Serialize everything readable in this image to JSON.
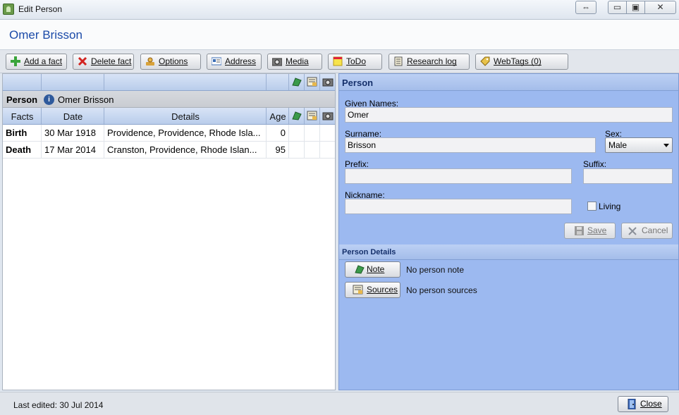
{
  "window": {
    "title": "Edit Person",
    "swap_glyph": "⇔",
    "min_glyph": "▭",
    "max_glyph": "▣",
    "close_glyph": "✕"
  },
  "header": {
    "person_name": "Omer Brisson"
  },
  "toolbar": {
    "add_fact": "Add a fact",
    "delete_fact": "Delete fact",
    "options": "Options",
    "address": "Address",
    "media": "Media",
    "todo": "ToDo",
    "research_log": "Research log",
    "webtags": "WebTags (0)"
  },
  "facts_table": {
    "person_label": "Person",
    "person_name": "Omer Brisson",
    "info_glyph": "i",
    "headers": {
      "facts": "Facts",
      "date": "Date",
      "details": "Details",
      "age": "Age"
    },
    "rows": [
      {
        "fact": "Birth",
        "date": "30 Mar 1918",
        "details": "Providence, Providence, Rhode Isla...",
        "age": "0"
      },
      {
        "fact": "Death",
        "date": "17 Mar 2014",
        "details": "Cranston, Providence, Rhode Islan...",
        "age": "95"
      }
    ]
  },
  "person_form": {
    "section_title": "Person",
    "given_names_label": "Given Names:",
    "given_names_value": "Omer",
    "surname_label": "Surname:",
    "surname_value": "Brisson",
    "sex_label": "Sex:",
    "sex_value": "Male",
    "prefix_label": "Prefix:",
    "prefix_value": "",
    "suffix_label": "Suffix:",
    "suffix_value": "",
    "nickname_label": "Nickname:",
    "nickname_value": "",
    "living_label": "Living",
    "living_checked": false,
    "save_label": "Save",
    "cancel_label": "Cancel"
  },
  "person_details": {
    "section_title": "Person Details",
    "note_button": "Note",
    "note_text": "No person note",
    "sources_button": "Sources",
    "sources_text": "No person sources"
  },
  "status": {
    "last_edited": "Last edited: 30 Jul 2014",
    "close_label": "Close"
  },
  "colors": {
    "accent_title": "#1b4aa8",
    "panel_blue": "#9cb9f0",
    "header_blue": "#b9cdeb"
  },
  "icons": {
    "add_fact": "plus-icon",
    "delete_fact": "x-icon",
    "options": "options-icon",
    "address": "address-card-icon",
    "media": "camera-icon",
    "todo": "sticky-note-icon",
    "research_log": "notebook-icon",
    "webtags": "tag-icon",
    "note": "note-icon",
    "sources": "sources-icon",
    "save": "floppy-icon",
    "cancel": "cancel-x-icon",
    "close": "door-icon"
  }
}
